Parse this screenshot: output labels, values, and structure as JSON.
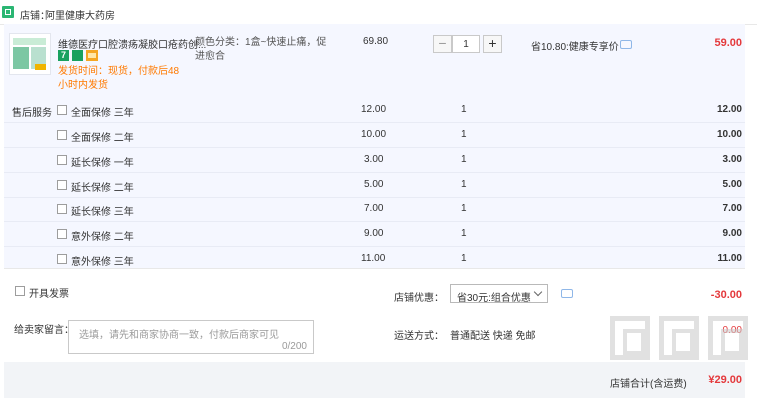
{
  "shop": {
    "icon": "shop-icon",
    "label": "店铺：",
    "name": "阿里健康大药房"
  },
  "item": {
    "title": "维德医疗口腔溃疡凝胶口疮药创...",
    "tag_number": "7",
    "tag_icon": "health-badge-icon",
    "shipping": "发货时间：现货，付款后48小时内发货",
    "spec": "颜色分类：1盒~快速止痛，促进愈合",
    "unit_price": "69.80",
    "quantity": "1",
    "minus_label": "−",
    "plus_label": "+",
    "discount": "省10.80:健康专享价",
    "total": "59.00"
  },
  "services": {
    "label": "售后服务",
    "options": [
      {
        "name": "全面保修 三年",
        "price": "12.00",
        "qty": "1",
        "total": "12.00"
      },
      {
        "name": "全面保修 二年",
        "price": "10.00",
        "qty": "1",
        "total": "10.00"
      },
      {
        "name": "延长保修 一年",
        "price": "3.00",
        "qty": "1",
        "total": "3.00"
      },
      {
        "name": "延长保修 二年",
        "price": "5.00",
        "qty": "1",
        "total": "5.00"
      },
      {
        "name": "延长保修 三年",
        "price": "7.00",
        "qty": "1",
        "total": "7.00"
      },
      {
        "name": "意外保修 二年",
        "price": "9.00",
        "qty": "1",
        "total": "9.00"
      },
      {
        "name": "意外保修 三年",
        "price": "11.00",
        "qty": "1",
        "total": "11.00"
      }
    ]
  },
  "invoice": {
    "label": "开具发票"
  },
  "coupon": {
    "label": "店铺优惠：",
    "selected": "省30元:组合优惠",
    "amount": "-30.00"
  },
  "message": {
    "label": "给卖家留言：",
    "placeholder": "选填，请先和商家协商一致，付款后商家可见",
    "counter": "0/200"
  },
  "delivery": {
    "label": "运送方式：",
    "method": "普通配送 快递 免邮",
    "fee": "0.00"
  },
  "summary": {
    "label": "店铺合计(含运费)",
    "total": "¥29.00"
  },
  "colors": {
    "accent_red": "#e4393c",
    "orange": "#ff7a00",
    "item_bg": "#f5f7ff",
    "shop_green": "#2bb673"
  }
}
